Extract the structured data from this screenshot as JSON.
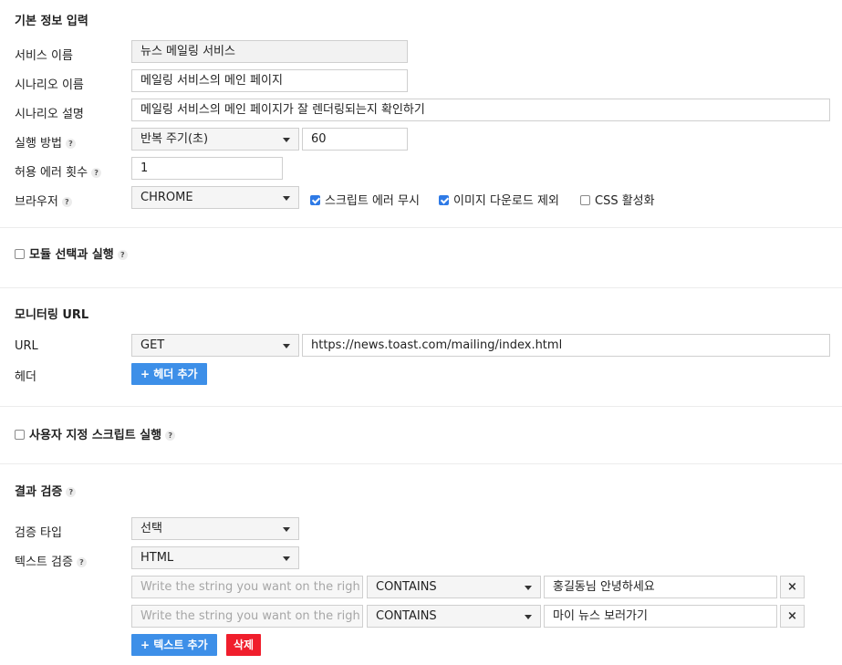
{
  "basic": {
    "title": "기본 정보 입력",
    "service_name_label": "서비스 이름",
    "service_name_value": "뉴스 메일링 서비스",
    "scenario_name_label": "시나리오 이름",
    "scenario_name_value": "메일링 서비스의 메인 페이지",
    "scenario_desc_label": "시나리오 설명",
    "scenario_desc_value": "메일링 서비스의 메인 페이지가 잘 렌더링되는지 확인하기",
    "run_method_label": "실행 방법",
    "run_method_select": "반복 주기(초)",
    "run_method_value": "60",
    "error_count_label": "허용 에러 횟수",
    "error_count_value": "1",
    "browser_label": "브라우저",
    "browser_select": "CHROME",
    "opt_script_error": "스크립트 에러 무시",
    "opt_script_error_checked": true,
    "opt_image_exclude": "이미지 다운로드 제외",
    "opt_image_exclude_checked": true,
    "opt_css": "CSS 활성화",
    "opt_css_checked": false
  },
  "module": {
    "label": "모듈 선택과 실행"
  },
  "monitoring": {
    "title": "모니터링 URL",
    "url_label": "URL",
    "method_select": "GET",
    "url_value": "https://news.toast.com/mailing/index.html",
    "header_label": "헤더",
    "add_header_button": "+ 헤더 추가"
  },
  "custom_script": {
    "label": "사용자 지정 스크립트 실행"
  },
  "verify": {
    "title": "결과 검증",
    "type_label": "검증 타입",
    "type_select": "선택",
    "text_label": "텍스트 검증",
    "text_select": "HTML",
    "rows": [
      {
        "placeholder": "Write the string you want on the righ",
        "op": "CONTAINS",
        "value": "홍길동님 안녕하세요",
        "remove": "×"
      },
      {
        "placeholder": "Write the string you want on the righ",
        "op": "CONTAINS",
        "value": "마이 뉴스 보러가기",
        "remove": "×"
      }
    ],
    "add_text_button": "+ 텍스트 추가",
    "delete_button": "삭제"
  },
  "help_glyph": "?",
  "colors": {
    "primary_button": "#3d8fe8",
    "danger_button": "#f01e2c",
    "checkbox_checked": "#2e7ae6"
  }
}
